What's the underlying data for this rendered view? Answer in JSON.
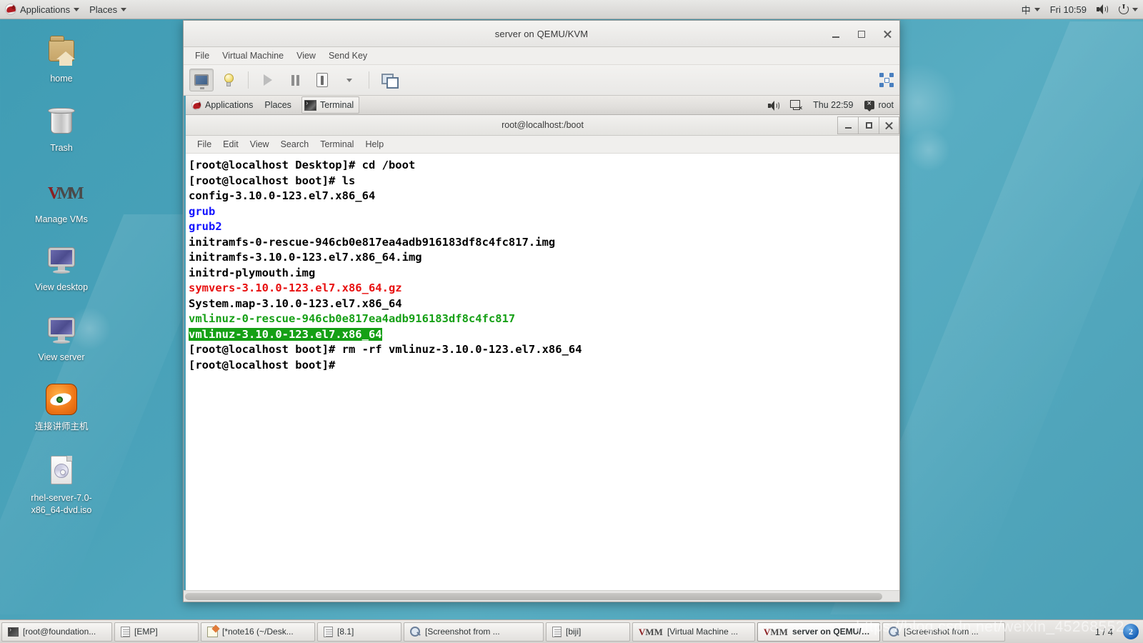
{
  "host_panel": {
    "applications_label": "Applications",
    "places_label": "Places",
    "input_method": "中",
    "clock": "Fri 10:59"
  },
  "desktop_icons": [
    {
      "label": "home",
      "icon": "home-folder-icon"
    },
    {
      "label": "Trash",
      "icon": "trash-icon"
    },
    {
      "label": "Manage VMs",
      "icon": "virt-manager-icon"
    },
    {
      "label": "View desktop",
      "icon": "monitor-icon"
    },
    {
      "label": "View server",
      "icon": "monitor-icon"
    },
    {
      "label": "连接讲师主机",
      "icon": "firefox-icon"
    },
    {
      "label": "rhel-server-7.0-x86_64-dvd.iso",
      "icon": "iso-disc-icon"
    }
  ],
  "vm_window": {
    "title": "server on QEMU/KVM",
    "menus": [
      "File",
      "Virtual Machine",
      "View",
      "Send Key"
    ],
    "toolbar": [
      {
        "name": "console-view-button",
        "icon": "monitor-icon",
        "active": true
      },
      {
        "name": "details-view-button",
        "icon": "lightbulb-icon",
        "active": false
      },
      {
        "name": "run-button",
        "icon": "play-icon",
        "active": false
      },
      {
        "name": "pause-button",
        "icon": "pause-icon",
        "active": false
      },
      {
        "name": "shutdown-button",
        "icon": "power-switch-icon",
        "active": false
      },
      {
        "name": "shutdown-menu-button",
        "icon": "chevron-down-icon",
        "active": false
      },
      {
        "name": "snapshots-button",
        "icon": "screens-icon",
        "active": false
      },
      {
        "name": "fullscreen-button",
        "icon": "fullscreen-icon",
        "active": false
      }
    ]
  },
  "guest_panel": {
    "applications_label": "Applications",
    "places_label": "Places",
    "task_label": "Terminal",
    "clock": "Thu 22:59",
    "user": "root"
  },
  "terminal_window": {
    "title": "root@localhost:/boot",
    "menus": [
      "File",
      "Edit",
      "View",
      "Search",
      "Terminal",
      "Help"
    ],
    "colors": {
      "directory": "#1414ff",
      "archive": "#e81010",
      "executable": "#16a016",
      "highlight_bg": "#15a015",
      "highlight_fg": "#ffffff"
    },
    "lines": [
      [
        {
          "text": "[root@localhost Desktop]# cd /boot",
          "style": "white"
        }
      ],
      [
        {
          "text": "[root@localhost boot]# ls",
          "style": "white"
        }
      ],
      [
        {
          "text": "config-3.10.0-123.el7.x86_64",
          "style": "white"
        }
      ],
      [
        {
          "text": "grub",
          "style": "blue"
        }
      ],
      [
        {
          "text": "grub2",
          "style": "blue"
        }
      ],
      [
        {
          "text": "initramfs-0-rescue-946cb0e817ea4adb916183df8c4fc817.img",
          "style": "white"
        }
      ],
      [
        {
          "text": "initramfs-3.10.0-123.el7.x86_64.img",
          "style": "white"
        }
      ],
      [
        {
          "text": "initrd-plymouth.img",
          "style": "white"
        }
      ],
      [
        {
          "text": "symvers-3.10.0-123.el7.x86_64.gz",
          "style": "red"
        }
      ],
      [
        {
          "text": "System.map-3.10.0-123.el7.x86_64",
          "style": "white"
        }
      ],
      [
        {
          "text": "vmlinuz-0-rescue-946cb0e817ea4adb916183df8c4fc817",
          "style": "green"
        }
      ],
      [
        {
          "text": "vmlinuz-3.10.0-123.el7.x86_64",
          "style": "highlight"
        }
      ],
      [
        {
          "text": "[root@localhost boot]# rm -rf vmlinuz-3.10.0-123.el7.x86_64",
          "style": "white"
        }
      ],
      [
        {
          "text": "[root@localhost boot]#",
          "style": "white"
        }
      ]
    ]
  },
  "taskbar": {
    "items": [
      {
        "label": "[root@foundation...",
        "icon": "terminal-icon",
        "active": false
      },
      {
        "label": "[EMP]",
        "icon": "document-icon",
        "active": false
      },
      {
        "label": "[*note16 (~/Desk...",
        "icon": "notepad-icon",
        "active": false
      },
      {
        "label": "[8.1]",
        "icon": "document-icon",
        "active": false
      },
      {
        "label": "[Screenshot from ...",
        "icon": "search-icon",
        "active": false
      },
      {
        "label": "[biji]",
        "icon": "document-icon",
        "active": false
      },
      {
        "label": "[Virtual Machine ...",
        "icon": "virt-manager-icon",
        "active": false
      },
      {
        "label": "server on QEMU/K...",
        "icon": "virt-manager-icon",
        "active": true
      },
      {
        "label": "[Screenshot from ...",
        "icon": "search-icon",
        "active": false
      }
    ],
    "pager": "1 / 4",
    "badge": "2"
  },
  "watermark": "https://blog.csdn.net/weixin_45268552"
}
